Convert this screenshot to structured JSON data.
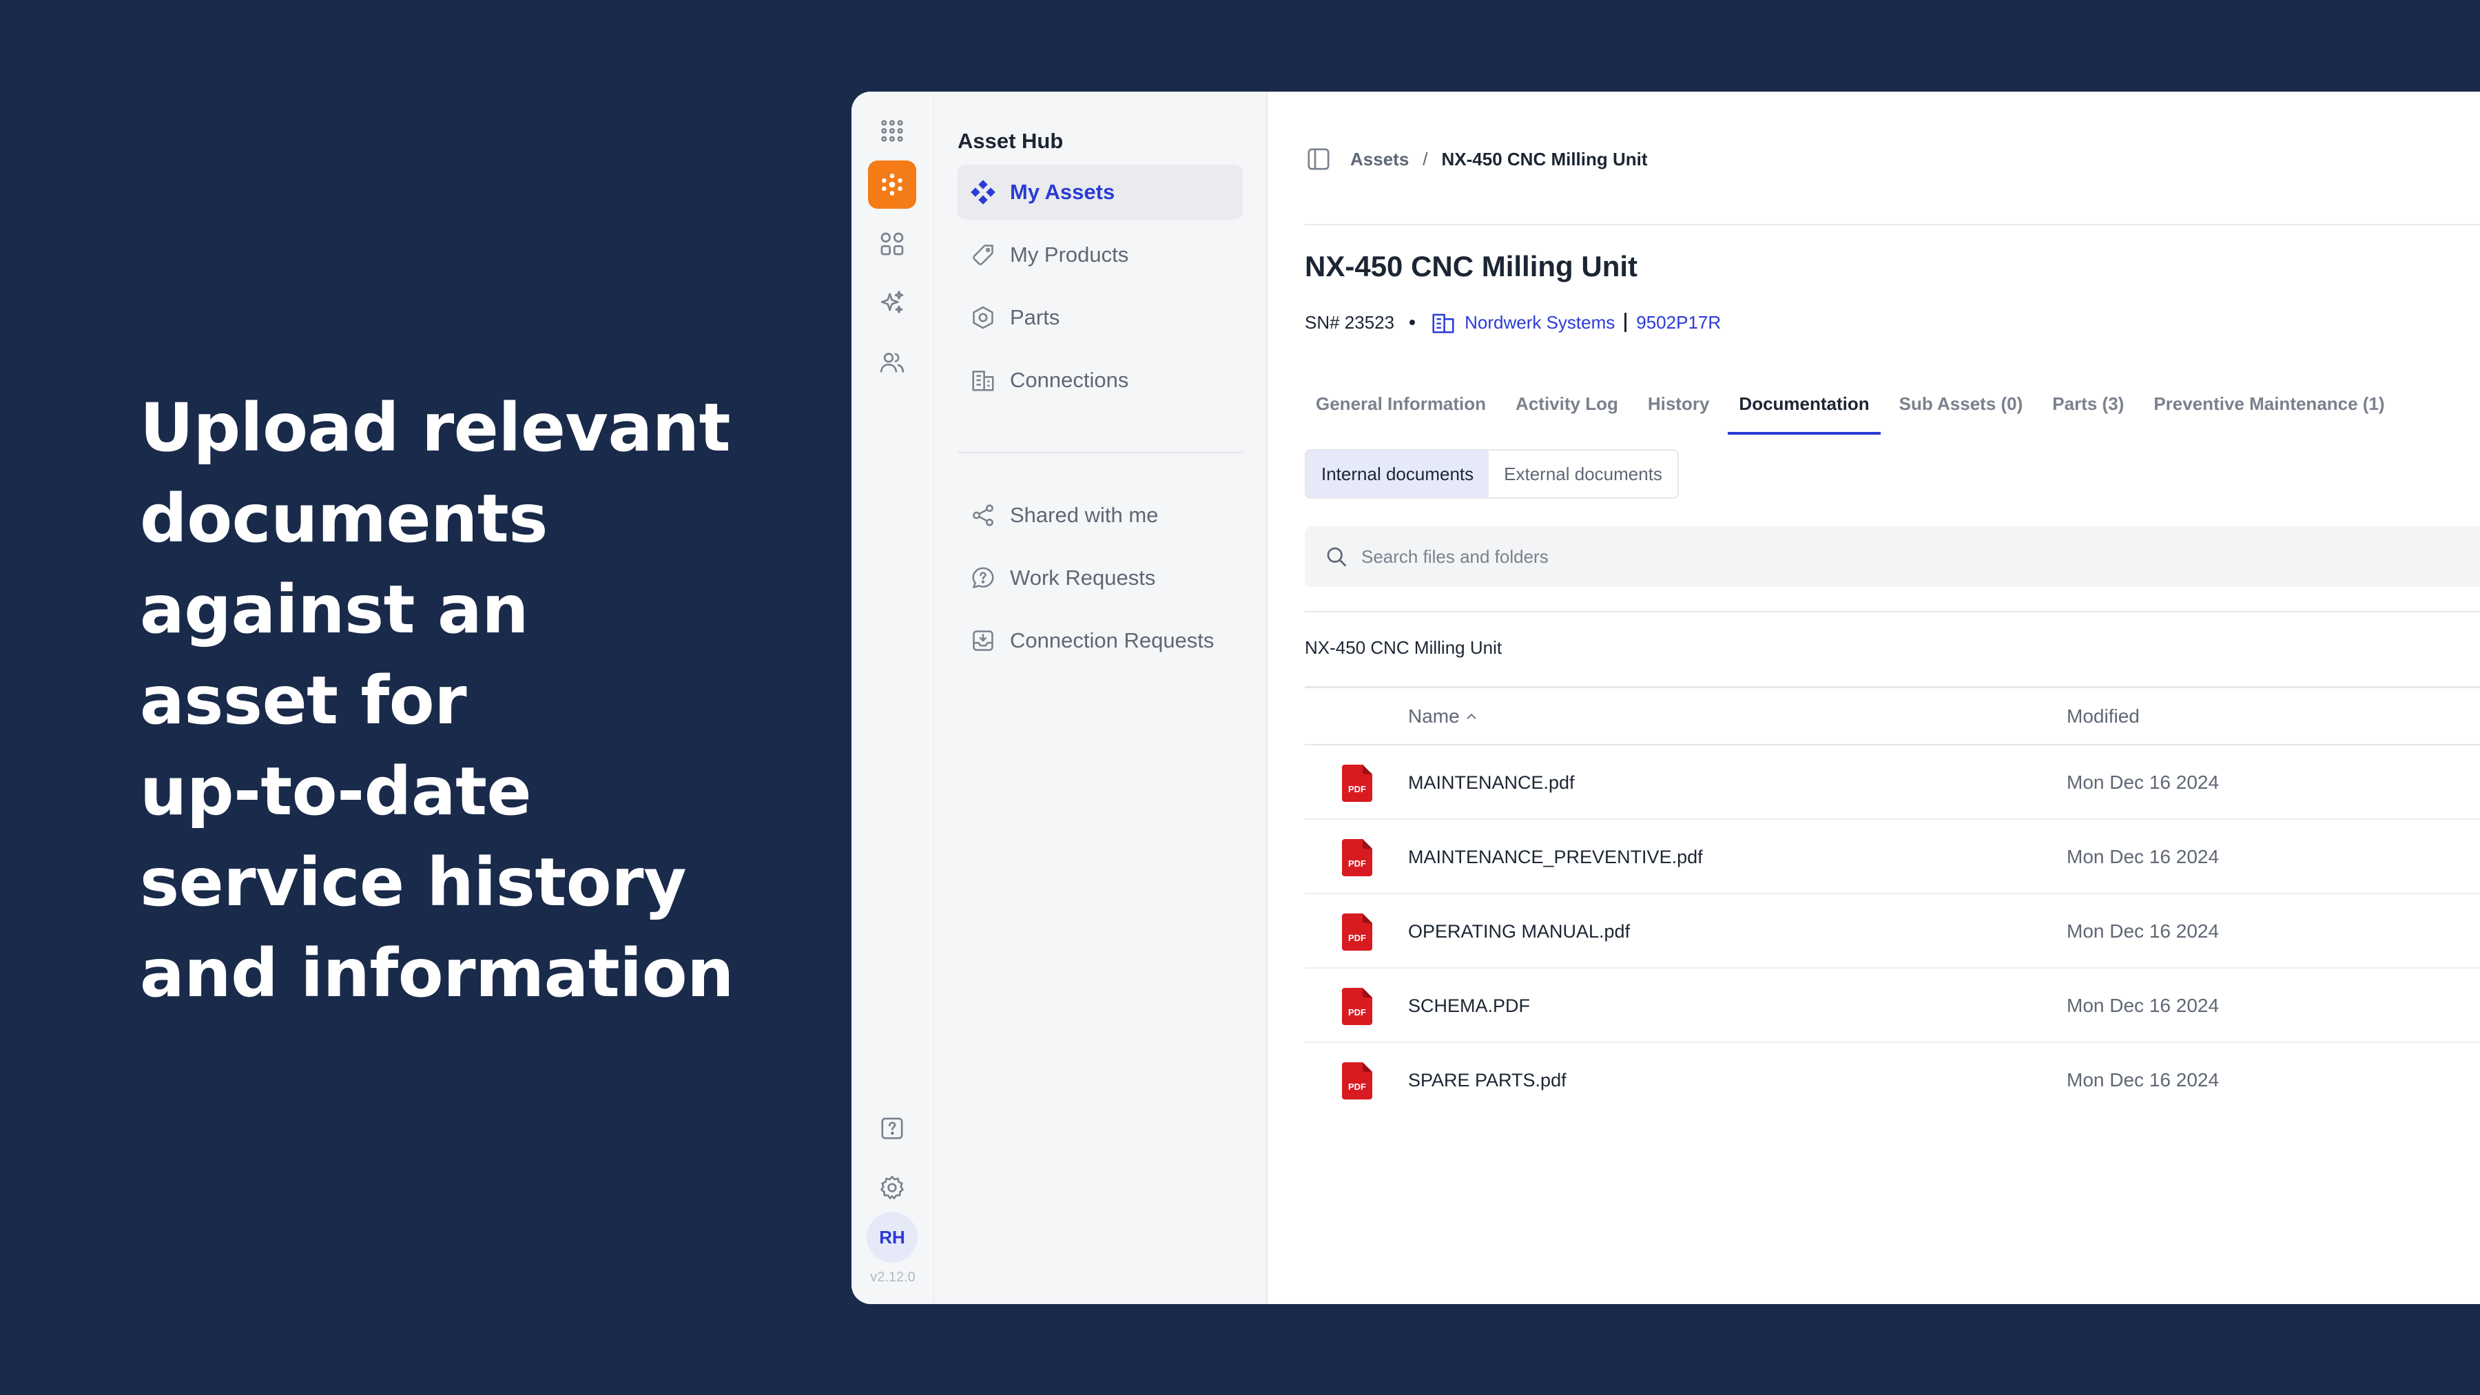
{
  "hero": {
    "lines": [
      "Upload relevant",
      "documents",
      "against an",
      "asset for",
      "up-to-date",
      "service history",
      "and information"
    ]
  },
  "rail": {
    "avatar_initials": "RH",
    "version": "v2.12.0"
  },
  "sidebar": {
    "title": "Asset Hub",
    "items": [
      {
        "label": "My Assets"
      },
      {
        "label": "My Products"
      },
      {
        "label": "Parts"
      },
      {
        "label": "Connections"
      }
    ],
    "items2": [
      {
        "label": "Shared with me"
      },
      {
        "label": "Work Requests"
      },
      {
        "label": "Connection Requests"
      }
    ]
  },
  "breadcrumb": {
    "root": "Assets",
    "separator": "/",
    "current": "NX-450 CNC Milling Unit"
  },
  "asset": {
    "title": "NX-450 CNC Milling Unit",
    "serial": "SN# 23523",
    "company": "Nordwerk Systems",
    "code": "9502P17R"
  },
  "tabs": [
    {
      "label": "General Information"
    },
    {
      "label": "Activity Log"
    },
    {
      "label": "History"
    },
    {
      "label": "Documentation"
    },
    {
      "label": "Sub Assets (0)"
    },
    {
      "label": "Parts (3)"
    },
    {
      "label": "Preventive Maintenance (1)"
    }
  ],
  "segments": {
    "internal": "Internal documents",
    "external": "External documents"
  },
  "search": {
    "placeholder": "Search files and folders"
  },
  "folder": {
    "name": "NX-450 CNC Milling Unit"
  },
  "table": {
    "col_name": "Name",
    "col_modified": "Modified",
    "rows": [
      {
        "name": "MAINTENANCE.pdf",
        "modified": "Mon Dec 16 2024"
      },
      {
        "name": "MAINTENANCE_PREVENTIVE.pdf",
        "modified": "Mon Dec 16 2024"
      },
      {
        "name": "OPERATING MANUAL.pdf",
        "modified": "Mon Dec 16 2024"
      },
      {
        "name": "SCHEMA.PDF",
        "modified": "Mon Dec 16 2024"
      },
      {
        "name": "SPARE PARTS.pdf",
        "modified": "Mon Dec 16 2024"
      }
    ]
  },
  "icons": {
    "pdf_label": "PDF"
  },
  "colors": {
    "background": "#192a4a",
    "accent": "#2a3bd6",
    "brand": "#f47b16",
    "pdf_red": "#d81b21"
  }
}
